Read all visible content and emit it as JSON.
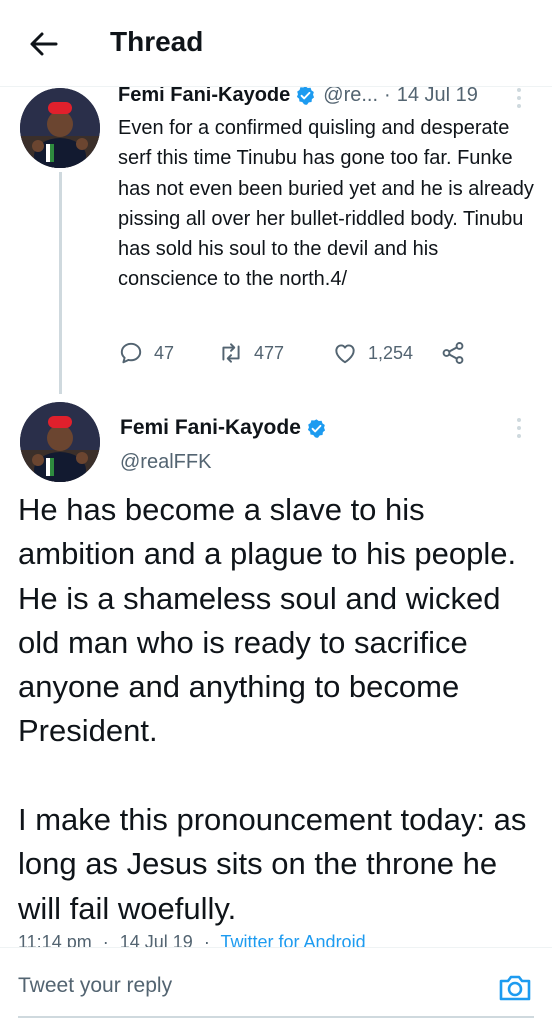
{
  "header": {
    "title": "Thread",
    "back_icon": "arrow-left-icon"
  },
  "tweet1": {
    "name": "Femi Fani-Kayode",
    "handle": "@re...",
    "separator": "·",
    "date": "14 Jul 19",
    "body": "Even for a confirmed quisling and desperate serf this time Tinubu has gone too far. Funke has not even been buried yet and he is already pissing all over her bullet-riddled body. Tinubu has sold his soul to the devil and his conscience to the north.4/",
    "replies": "47",
    "retweets": "477",
    "likes": "1,254",
    "icons": [
      "reply-icon",
      "retweet-icon",
      "like-icon",
      "share-icon"
    ]
  },
  "tweet2": {
    "name": "Femi Fani-Kayode",
    "handle": "@realFFK",
    "body": "He has become a slave to his ambition and a plague to his people. He is a shameless soul and wicked old man who is ready to sacrifice anyone and anything to become President.\n\nI make this pronouncement today: as long as Jesus sits on the throne he will fail woefully.",
    "time": "11:14 pm",
    "date": "14 Jul 19",
    "separator": "·",
    "source": "Twitter for Android"
  },
  "reply": {
    "placeholder": "Tweet your reply",
    "camera_icon": "camera-icon"
  },
  "colors": {
    "accent": "#1d9bf0",
    "text": "#0f1419",
    "muted": "#536471",
    "divider": "#eff3f4",
    "avatar_cap": "#e0202c"
  }
}
